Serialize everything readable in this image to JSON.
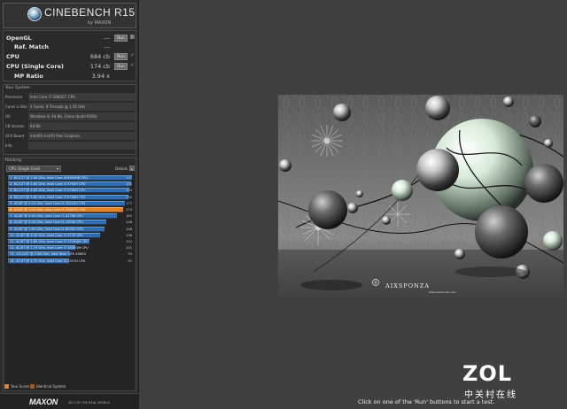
{
  "app": {
    "title": "CINEBENCH R15",
    "subtitle": "by MAXON"
  },
  "scores": {
    "opengl": {
      "label": "OpenGL",
      "value": "---",
      "run": "Run"
    },
    "ref_match": {
      "label": "Ref. Match",
      "value": "---"
    },
    "cpu": {
      "label": "CPU",
      "value": "684 cb",
      "run": "Run"
    },
    "cpu_single": {
      "label": "CPU (Single Core)",
      "value": "174 cb",
      "run": "Run"
    },
    "mp_ratio": {
      "label": "MP Ratio",
      "value": "3.94 x"
    }
  },
  "system": {
    "header": "Your System",
    "rows": [
      {
        "key": "Processor",
        "value": "Intel Core i7-1065G7 CPU"
      },
      {
        "key": "Cores x GHz",
        "value": "4 Cores, 8 Threads @ 1.50 GHz"
      },
      {
        "key": "OS",
        "value": "Windows 8, 64 Bit, China (build 9200)"
      },
      {
        "key": "CB Version",
        "value": "64 Bit"
      },
      {
        "key": "GFX Board",
        "value": "Intel(R) Iris(R) Plus Graphics"
      },
      {
        "key": "Info",
        "value": ""
      }
    ]
  },
  "ranking": {
    "header": "Ranking",
    "selected": "CPU (Single Core)",
    "details_label": "Details",
    "items": [
      {
        "label": "1. 6C/12T @ 2.40 GHz, Intel Core i9-8950HK CPU",
        "score": "187",
        "level": 1.0,
        "highlight": false
      },
      {
        "label": "2. 6C/12T @ 2.60 GHz, Intel Core i7-9750H CPU",
        "score": "186",
        "level": 0.99,
        "highlight": false
      },
      {
        "label": "3. 6C/12T @ 2.60 GHz, Intel Core i7-9750H CPU",
        "score": "183",
        "level": 0.975,
        "highlight": false
      },
      {
        "label": "4. 6C/12T @ 2.60 GHz, Intel Core i7-9750H CPU",
        "score": "182",
        "level": 0.97,
        "highlight": false
      },
      {
        "label": "5. 4C/8T @ 2.13 GHz, Intel Core i5-10210U CPU",
        "score": "177",
        "level": 0.945,
        "highlight": false
      },
      {
        "label": "6. 4C/8T @ 1.50 GHz, Intel Core i7-1065G7 CPU",
        "score": "174",
        "level": 0.93,
        "highlight": true
      },
      {
        "label": "7. 4C/8T @ 4.40 GHz, Intel Core i7-4770K CPU",
        "score": "165",
        "level": 0.88,
        "highlight": false
      },
      {
        "label": "8. 4C/8T @ 3.30 GHz, Intel Core i5-1950K CPU",
        "score": "148",
        "level": 0.795,
        "highlight": false
      },
      {
        "label": "9. 4C/8T @ 1.80 GHz, Intel Core i5-8250U CPU",
        "score": "146",
        "level": 0.78,
        "highlight": false
      },
      {
        "label": "10. 4C/8T @ 3.40 GHz, Intel Core i7-3770 CPU",
        "score": "138",
        "level": 0.74,
        "highlight": false
      },
      {
        "label": "11. 4C/8T @ 2.60 GHz, Intel Core i7-3720QM CPU",
        "score": "122",
        "level": 0.655,
        "highlight": false
      },
      {
        "label": "12. 4C/8T @ 2.79 GHz, Intel Core i7-3840QM CPU",
        "score": "101",
        "level": 0.54,
        "highlight": false
      },
      {
        "label": "13. 12C/24T @ 2.66 GHz, Intel Xeon CPU X5650",
        "score": "93",
        "level": 0.5,
        "highlight": false
      },
      {
        "label": "14. 2C/4T @ 1.70 GHz, Intel Core i5-3317U CPU",
        "score": "91",
        "level": 0.49,
        "highlight": false
      }
    ]
  },
  "legend": {
    "your_score": "Your Score",
    "identical": "Identical System"
  },
  "colors": {
    "bar_blue": "#2f6cb0",
    "bar_orange": "#e0842a",
    "identical_brown": "#a05a28"
  },
  "footer": {
    "brand": "MAXON",
    "tagline": "3D FOR THE REAL WORLD"
  },
  "render": {
    "watermark": "AIXSPONZA",
    "watermark_sub": "www.aixsponza.com"
  },
  "status": "Click on one of the 'Run' buttons to start a test.",
  "overlay": {
    "zol": "ZOL",
    "zol_cn": "中关村在线"
  }
}
